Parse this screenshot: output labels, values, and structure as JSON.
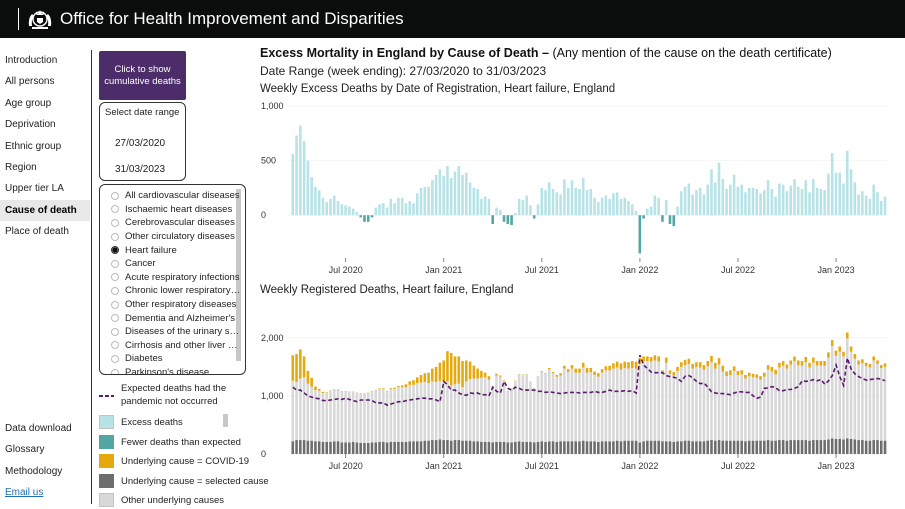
{
  "header": {
    "title": "Office for Health Improvement and Disparities",
    "crest_icon": "royal-crest-icon"
  },
  "nav": {
    "items": [
      {
        "label": "Introduction",
        "active": false
      },
      {
        "label": "All persons",
        "active": false
      },
      {
        "label": "Age group",
        "active": false
      },
      {
        "label": "Deprivation",
        "active": false
      },
      {
        "label": "Ethnic group",
        "active": false
      },
      {
        "label": "Region",
        "active": false
      },
      {
        "label": "Upper tier LA",
        "active": false
      },
      {
        "label": "Cause of death",
        "active": true
      },
      {
        "label": "Place of death",
        "active": false
      }
    ],
    "bottom": [
      {
        "label": "Data download",
        "link": false
      },
      {
        "label": "Glossary",
        "link": false
      },
      {
        "label": "Methodology",
        "link": false
      },
      {
        "label": "Email us",
        "link": true
      }
    ]
  },
  "controls": {
    "cumulative_button": "Click to show cumulative deaths",
    "date_range_label": "Select date range",
    "date_from": "27/03/2020",
    "date_to": "31/03/2023",
    "causes": [
      {
        "label": "All cardiovascular diseases",
        "selected": false
      },
      {
        "label": "Ischaemic heart diseases",
        "selected": false
      },
      {
        "label": "Cerebrovascular diseases",
        "selected": false
      },
      {
        "label": "Other circulatory diseases",
        "selected": false
      },
      {
        "label": "Heart failure",
        "selected": true
      },
      {
        "label": "Cancer",
        "selected": false
      },
      {
        "label": "Acute respiratory infections",
        "selected": false
      },
      {
        "label": "Chronic lower respiratory…",
        "selected": false
      },
      {
        "label": "Other respiratory diseases",
        "selected": false
      },
      {
        "label": "Dementia and Alzheimer's",
        "selected": false
      },
      {
        "label": "Diseases of the urinary s…",
        "selected": false
      },
      {
        "label": "Cirrhosis and other liver …",
        "selected": false
      },
      {
        "label": "Diabetes",
        "selected": false
      },
      {
        "label": "Parkinson's disease",
        "selected": false
      }
    ]
  },
  "legend": {
    "items": [
      {
        "label": "Expected deaths had the pandemic not occurred",
        "kind": "dashed",
        "color": "#5b1a6e"
      },
      {
        "label": "Excess deaths",
        "kind": "box",
        "color": "#b8e3e6"
      },
      {
        "label": "Fewer deaths than expected",
        "kind": "box",
        "color": "#52a6a3"
      },
      {
        "label": "Underlying cause  = COVID-19",
        "kind": "box",
        "color": "#e5a90d"
      },
      {
        "label": "Underlying cause = selected cause",
        "kind": "box",
        "color": "#6d6d6d"
      },
      {
        "label": "Other underlying causes",
        "kind": "box",
        "color": "#d8d8d8"
      }
    ]
  },
  "main": {
    "title_bold": "Excess Mortality in England by Cause of Death –",
    "title_rest": " (Any mention of the cause on the death certificate)",
    "date_range": "Date Range (week ending): 27/03/2020 to 31/03/2023"
  },
  "chart_data": [
    {
      "type": "bar",
      "title": "Weekly Excess Deaths by Date of Registration, Heart failure, England",
      "xlabel": "",
      "ylabel": "",
      "ylim": [
        -300,
        1000
      ],
      "yticks": [
        "0",
        "500",
        "1,000"
      ],
      "ytick_values": [
        0,
        500,
        1000
      ],
      "xticks": [
        "Jul 2020",
        "Jan 2021",
        "Jul 2021",
        "Jan 2022",
        "Jul 2022",
        "Jan 2023"
      ],
      "xtick_weeks": [
        14,
        40,
        66,
        92,
        118,
        144
      ],
      "colors": {
        "excess": "#b8e3e6",
        "fewer": "#52a6a3"
      },
      "values": [
        560,
        730,
        820,
        680,
        500,
        350,
        260,
        230,
        160,
        120,
        150,
        180,
        130,
        100,
        90,
        80,
        60,
        30,
        -20,
        -60,
        -60,
        -20,
        70,
        100,
        110,
        70,
        150,
        110,
        160,
        160,
        110,
        130,
        110,
        200,
        250,
        260,
        260,
        320,
        370,
        420,
        360,
        450,
        340,
        400,
        450,
        370,
        390,
        300,
        250,
        240,
        150,
        170,
        150,
        -80,
        70,
        50,
        -60,
        -80,
        -90,
        20,
        150,
        140,
        180,
        90,
        -30,
        100,
        250,
        230,
        300,
        240,
        210,
        190,
        330,
        250,
        320,
        250,
        240,
        340,
        230,
        240,
        160,
        120,
        160,
        180,
        150,
        200,
        210,
        150,
        160,
        130,
        100,
        40,
        -350,
        -30,
        60,
        80,
        180,
        160,
        -60,
        140,
        -80,
        -100,
        80,
        220,
        260,
        290,
        190,
        230,
        250,
        190,
        280,
        420,
        300,
        480,
        330,
        240,
        280,
        370,
        260,
        280,
        210,
        250,
        250,
        240,
        200,
        230,
        320,
        240,
        170,
        290,
        280,
        220,
        270,
        330,
        260,
        240,
        320,
        210,
        330,
        250,
        240,
        230,
        380,
        570,
        390,
        390,
        290,
        590,
        420,
        300,
        190,
        220,
        180,
        150,
        280,
        210,
        130,
        170
      ]
    },
    {
      "type": "bar",
      "title": "Weekly Registered Deaths, Heart failure, England",
      "xlabel": "",
      "ylabel": "",
      "ylim": [
        0,
        2100
      ],
      "yticks": [
        "0",
        "1,000",
        "2,000"
      ],
      "ytick_values": [
        0,
        1000,
        2000
      ],
      "xticks": [
        "Jul 2020",
        "Jan 2021",
        "Jul 2021",
        "Jan 2022",
        "Jul 2022",
        "Jan 2023"
      ],
      "xtick_weeks": [
        14,
        40,
        66,
        92,
        118,
        144
      ],
      "colors": {
        "covid": "#e5a90d",
        "selected": "#6d6d6d",
        "other": "#d8d8d8",
        "expected": "#5b1a6e"
      },
      "note": "Stacked bars per week: selected cause (bottom), other underlying causes (middle), COVID-19 underlying (top); dashed line shows expected deaths",
      "series": [
        {
          "name": "Underlying cause = selected cause",
          "values": [
            220,
            240,
            240,
            240,
            230,
            230,
            220,
            220,
            210,
            210,
            210,
            220,
            220,
            200,
            200,
            200,
            210,
            200,
            190,
            190,
            190,
            200,
            200,
            210,
            210,
            200,
            210,
            210,
            210,
            210,
            210,
            220,
            220,
            220,
            220,
            230,
            230,
            240,
            240,
            250,
            240,
            240,
            230,
            240,
            240,
            230,
            230,
            230,
            220,
            220,
            210,
            210,
            210,
            200,
            210,
            210,
            210,
            200,
            200,
            210,
            220,
            210,
            210,
            210,
            200,
            210,
            220,
            210,
            220,
            220,
            210,
            220,
            220,
            220,
            220,
            220,
            220,
            230,
            220,
            220,
            220,
            210,
            220,
            220,
            220,
            220,
            230,
            220,
            230,
            230,
            230,
            230,
            200,
            220,
            230,
            230,
            230,
            230,
            220,
            220,
            220,
            210,
            220,
            220,
            230,
            230,
            220,
            220,
            220,
            220,
            230,
            240,
            230,
            240,
            230,
            230,
            230,
            230,
            230,
            230,
            220,
            230,
            230,
            230,
            230,
            230,
            240,
            230,
            230,
            240,
            240,
            230,
            240,
            240,
            240,
            240,
            240,
            230,
            240,
            240,
            240,
            240,
            250,
            270,
            260,
            260,
            250,
            270,
            260,
            250,
            240,
            240,
            230,
            230,
            240,
            240,
            230,
            230
          ]
        },
        {
          "name": "Other underlying causes",
          "values": [
            1040,
            1000,
            1060,
            1080,
            980,
            930,
            880,
            870,
            840,
            840,
            880,
            890,
            890,
            880,
            880,
            870,
            860,
            850,
            850,
            850,
            860,
            880,
            900,
            910,
            910,
            870,
            910,
            910,
            940,
            940,
            940,
            970,
            970,
            1000,
            1010,
            1010,
            990,
            1010,
            1000,
            1010,
            1010,
            1010,
            950,
            960,
            970,
            920,
            1020,
            1060,
            1080,
            1080,
            1100,
            1110,
            1070,
            920,
            1140,
            1120,
            1050,
            880,
            920,
            1050,
            1150,
            1150,
            1160,
            1030,
            930,
            1120,
            1200,
            1170,
            1240,
            1170,
            1120,
            1130,
            1250,
            1190,
            1250,
            1180,
            1180,
            1260,
            1180,
            1190,
            1140,
            1120,
            1180,
            1220,
            1220,
            1250,
            1260,
            1230,
            1250,
            1240,
            1250,
            1240,
            1350,
            1380,
            1370,
            1360,
            1380,
            1360,
            1160,
            1350,
            1160,
            1140,
            1210,
            1280,
            1300,
            1320,
            1250,
            1280,
            1270,
            1230,
            1280,
            1340,
            1240,
            1300,
            1190,
            1110,
            1130,
            1200,
            1130,
            1140,
            1080,
            1110,
            1090,
            1080,
            1050,
            1100,
            1210,
            1190,
            1140,
            1250,
            1280,
            1240,
            1300,
            1360,
            1290,
            1280,
            1340,
            1260,
            1330,
            1280,
            1280,
            1280,
            1410,
            1590,
            1430,
            1500,
            1430,
            1720,
            1500,
            1390,
            1300,
            1320,
            1280,
            1260,
            1370,
            1310,
            1250,
            1270
          ]
        },
        {
          "name": "Underlying cause  = COVID-19",
          "values": [
            440,
            480,
            500,
            360,
            220,
            150,
            60,
            30,
            20,
            10,
            5,
            5,
            5,
            5,
            5,
            5,
            5,
            5,
            5,
            5,
            5,
            5,
            5,
            10,
            10,
            10,
            15,
            20,
            20,
            30,
            50,
            60,
            80,
            100,
            130,
            150,
            180,
            220,
            260,
            310,
            360,
            520,
            560,
            480,
            470,
            450,
            360,
            300,
            220,
            170,
            120,
            80,
            60,
            40,
            30,
            20,
            10,
            5,
            5,
            5,
            5,
            5,
            5,
            5,
            5,
            5,
            10,
            10,
            20,
            20,
            30,
            40,
            50,
            50,
            60,
            70,
            70,
            80,
            80,
            70,
            60,
            60,
            60,
            70,
            80,
            90,
            100,
            110,
            110,
            110,
            120,
            120,
            100,
            80,
            80,
            80,
            90,
            90,
            60,
            90,
            60,
            60,
            70,
            80,
            90,
            90,
            80,
            80,
            90,
            80,
            90,
            110,
            100,
            110,
            100,
            80,
            80,
            80,
            70,
            70,
            60,
            60,
            60,
            60,
            60,
            70,
            80,
            80,
            80,
            80,
            80,
            70,
            70,
            80,
            80,
            80,
            90,
            80,
            90,
            80,
            80,
            80,
            90,
            100,
            90,
            90,
            80,
            100,
            90,
            80,
            70,
            70,
            60,
            60,
            70,
            60,
            50,
            60
          ]
        },
        {
          "name": "Expected deaths had the pandemic not occurred",
          "values": [
            1150,
            1100,
            1100,
            1050,
            1000,
            980,
            960,
            950,
            920,
            920,
            930,
            940,
            950,
            940,
            960,
            940,
            920,
            900,
            930,
            930,
            930,
            920,
            880,
            880,
            880,
            840,
            860,
            880,
            900,
            900,
            920,
            930,
            940,
            950,
            960,
            960,
            950,
            950,
            930,
            900,
            1250,
            1190,
            1100,
            1100,
            1050,
            1020,
            1010,
            1050,
            1040,
            1050,
            1020,
            1020,
            1000,
            1150,
            1080,
            1050,
            1250,
            1130,
            1100,
            1150,
            1130,
            1100,
            1100,
            1100,
            1100,
            1080,
            1080,
            1060,
            1070,
            1060,
            1050,
            1040,
            1050,
            1060,
            1060,
            1060,
            1050,
            1060,
            1060,
            1060,
            1080,
            1060,
            1060,
            1080,
            1100,
            1080,
            1080,
            1080,
            1090,
            1080,
            1090,
            1050,
            1700,
            1530,
            1470,
            1410,
            1400,
            1400,
            1400,
            1350,
            1330,
            1320,
            1300,
            1250,
            1340,
            1350,
            1310,
            1250,
            1210,
            1220,
            1150,
            1070,
            1050,
            1040,
            1040,
            1030,
            1020,
            1050,
            1070,
            1070,
            1060,
            1060,
            1000,
            960,
            980,
            1130,
            1140,
            1160,
            1140,
            1090,
            1090,
            1110,
            1110,
            1130,
            1160,
            1260,
            1250,
            1260,
            1280,
            1260,
            1280,
            1200,
            1260,
            1350,
            1530,
            1330,
            1180,
            1650,
            1460,
            1380,
            1330,
            1300,
            1270,
            1280,
            1290,
            1300,
            1290,
            1260
          ]
        }
      ]
    }
  ]
}
